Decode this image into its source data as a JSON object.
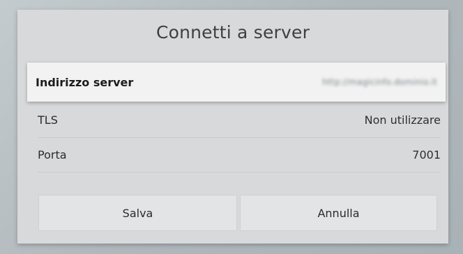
{
  "dialog": {
    "title": "Connetti a server",
    "fields": [
      {
        "label": "Indirizzo server",
        "value": "http://magicinfo.dominio.it"
      },
      {
        "label": "TLS",
        "value": "Non utilizzare"
      },
      {
        "label": "Porta",
        "value": "7001"
      }
    ],
    "buttons": {
      "save_label": "Salva",
      "cancel_label": "Annulla"
    }
  },
  "colors": {
    "dialog_bg": "#d7d9da",
    "focused_row_bg": "#f2f2f2",
    "text": "#2b2b2b"
  }
}
